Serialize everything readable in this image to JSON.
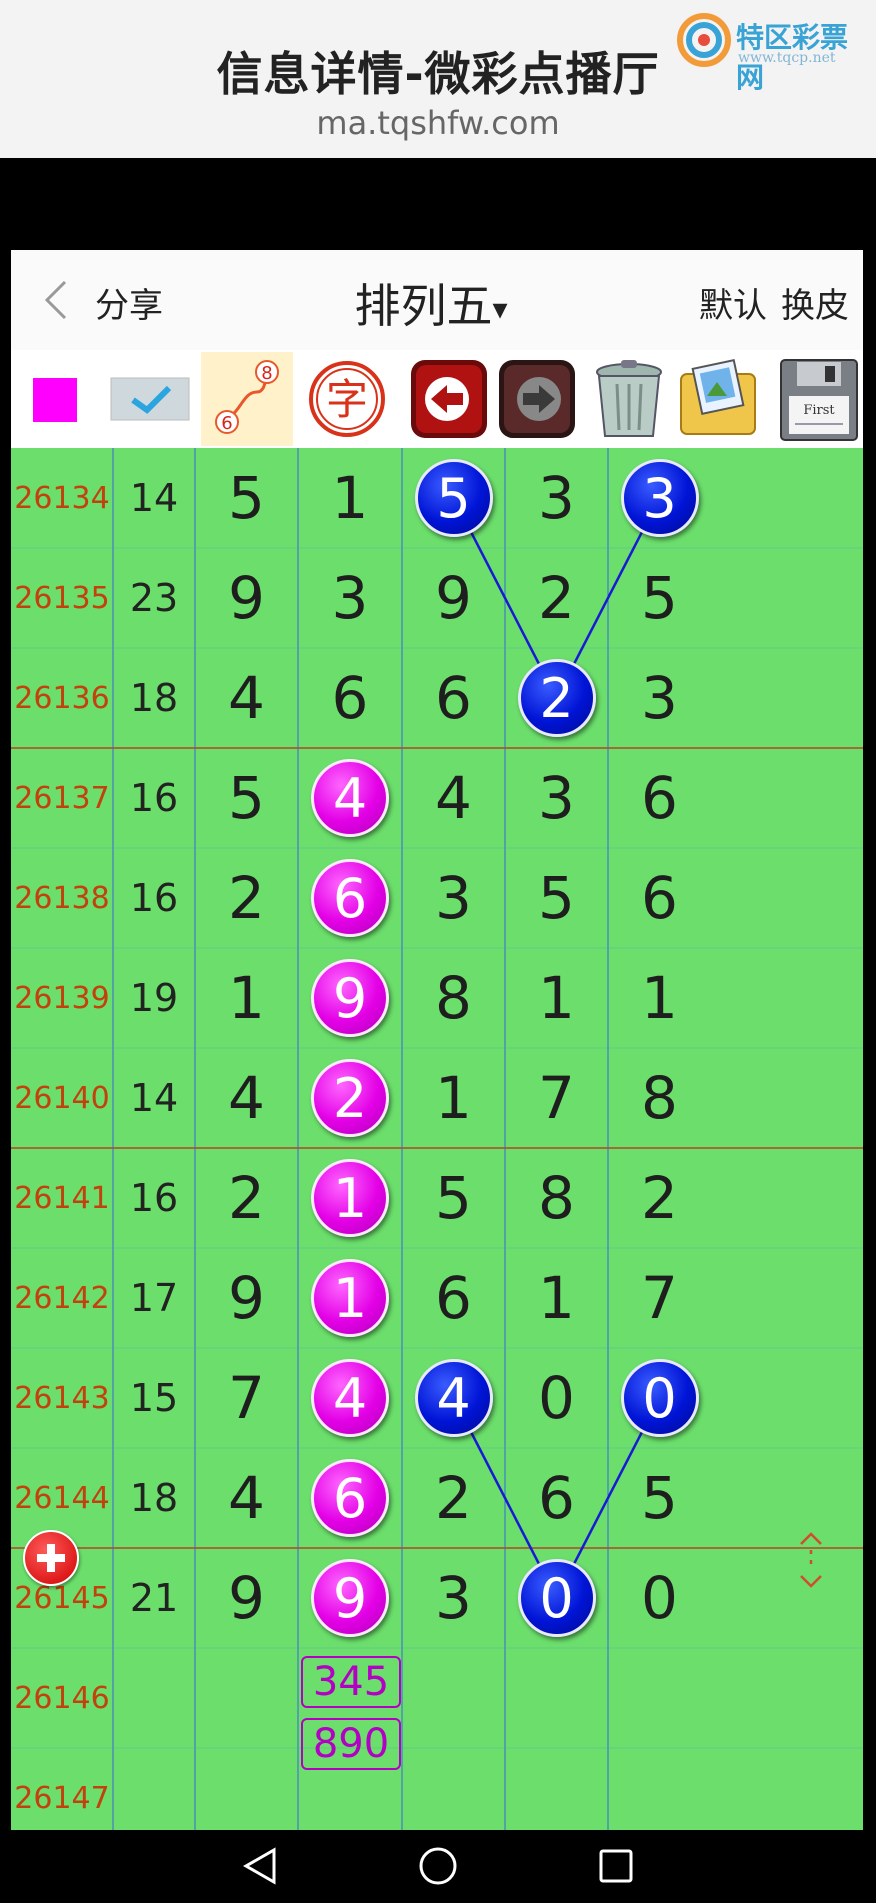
{
  "page": {
    "title": "信息详情-微彩点播厅",
    "url": "ma.tqshfw.com",
    "watermark": {
      "text": "特区彩票网",
      "url": "www.tqcp.net"
    }
  },
  "nav": {
    "share": "分享",
    "title": "排列五",
    "dropdown_glyph": "▾",
    "default": "默认",
    "skin": "换皮"
  },
  "toolbar": {
    "items": [
      "color-swatch",
      "check",
      "trend-line",
      "char",
      "undo",
      "redo",
      "trash",
      "image",
      "save"
    ],
    "trend_numbers": [
      "8",
      "6"
    ],
    "char_glyph": "字",
    "save_label": "First"
  },
  "colors": {
    "grid_bg": "#6bde6b",
    "issue_text": "#c2410c",
    "blue_ball": "#0014d6",
    "magenta_ball": "#e300e6",
    "swatch": "#ff00ff"
  },
  "rows": [
    {
      "issue": "26134",
      "sum": "14",
      "digits": [
        "5",
        "1",
        "5",
        "3",
        "3"
      ]
    },
    {
      "issue": "26135",
      "sum": "23",
      "digits": [
        "9",
        "3",
        "9",
        "2",
        "5"
      ]
    },
    {
      "issue": "26136",
      "sum": "18",
      "digits": [
        "4",
        "6",
        "6",
        "2",
        "3"
      ]
    },
    {
      "issue": "26137",
      "sum": "16",
      "digits": [
        "5",
        "4",
        "4",
        "3",
        "6"
      ]
    },
    {
      "issue": "26138",
      "sum": "16",
      "digits": [
        "2",
        "6",
        "3",
        "5",
        "6"
      ]
    },
    {
      "issue": "26139",
      "sum": "19",
      "digits": [
        "1",
        "9",
        "8",
        "1",
        "1"
      ]
    },
    {
      "issue": "26140",
      "sum": "14",
      "digits": [
        "4",
        "2",
        "1",
        "7",
        "8"
      ]
    },
    {
      "issue": "26141",
      "sum": "16",
      "digits": [
        "2",
        "1",
        "5",
        "8",
        "2"
      ]
    },
    {
      "issue": "26142",
      "sum": "17",
      "digits": [
        "9",
        "1",
        "6",
        "1",
        "7"
      ]
    },
    {
      "issue": "26143",
      "sum": "15",
      "digits": [
        "7",
        "4",
        "4",
        "0",
        "0"
      ]
    },
    {
      "issue": "26144",
      "sum": "18",
      "digits": [
        "4",
        "6",
        "2",
        "6",
        "5"
      ]
    },
    {
      "issue": "26145",
      "sum": "21",
      "digits": [
        "9",
        "9",
        "3",
        "0",
        "0"
      ]
    },
    {
      "issue": "26146",
      "sum": "",
      "digits": [
        "",
        "",
        "",
        "",
        ""
      ]
    },
    {
      "issue": "26147",
      "sum": "",
      "digits": [
        "",
        "",
        "",
        "",
        ""
      ]
    }
  ],
  "blue_balls": [
    {
      "row": 0,
      "col": 2
    },
    {
      "row": 0,
      "col": 4
    },
    {
      "row": 2,
      "col": 3
    },
    {
      "row": 9,
      "col": 2
    },
    {
      "row": 9,
      "col": 4
    },
    {
      "row": 11,
      "col": 3
    }
  ],
  "magenta_balls": [
    {
      "row": 3,
      "col": 1
    },
    {
      "row": 4,
      "col": 1
    },
    {
      "row": 5,
      "col": 1
    },
    {
      "row": 6,
      "col": 1
    },
    {
      "row": 7,
      "col": 1
    },
    {
      "row": 8,
      "col": 1
    },
    {
      "row": 9,
      "col": 1
    },
    {
      "row": 10,
      "col": 1
    },
    {
      "row": 11,
      "col": 1
    }
  ],
  "predictions": {
    "col": 1,
    "row": 12,
    "values": [
      "345",
      "890"
    ]
  },
  "fab": {
    "icon": "plus-icon"
  },
  "scroll_handle": {
    "icon": "expand-vertical-icon"
  }
}
